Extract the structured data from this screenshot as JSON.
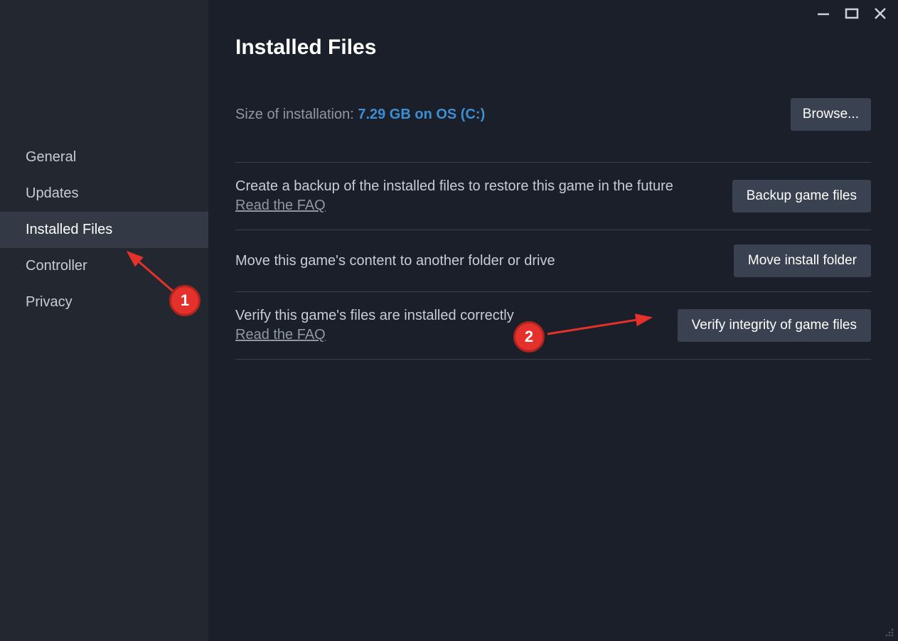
{
  "sidebar": {
    "items": [
      {
        "label": "General"
      },
      {
        "label": "Updates"
      },
      {
        "label": "Installed Files"
      },
      {
        "label": "Controller"
      },
      {
        "label": "Privacy"
      }
    ],
    "active_index": 2
  },
  "page": {
    "title": "Installed Files",
    "size_label": "Size of installation: ",
    "size_value": "7.29 GB on OS (C:)",
    "browse_button": "Browse...",
    "rows": [
      {
        "desc": "Create a backup of the installed files to restore this game in the future",
        "faq": "Read the FAQ",
        "button": "Backup game files"
      },
      {
        "desc": "Move this game's content to another folder or drive",
        "faq": "",
        "button": "Move install folder"
      },
      {
        "desc": "Verify this game's files are installed correctly",
        "faq": "Read the FAQ",
        "button": "Verify integrity of game files"
      }
    ]
  },
  "annotations": {
    "badge1": "1",
    "badge2": "2"
  }
}
